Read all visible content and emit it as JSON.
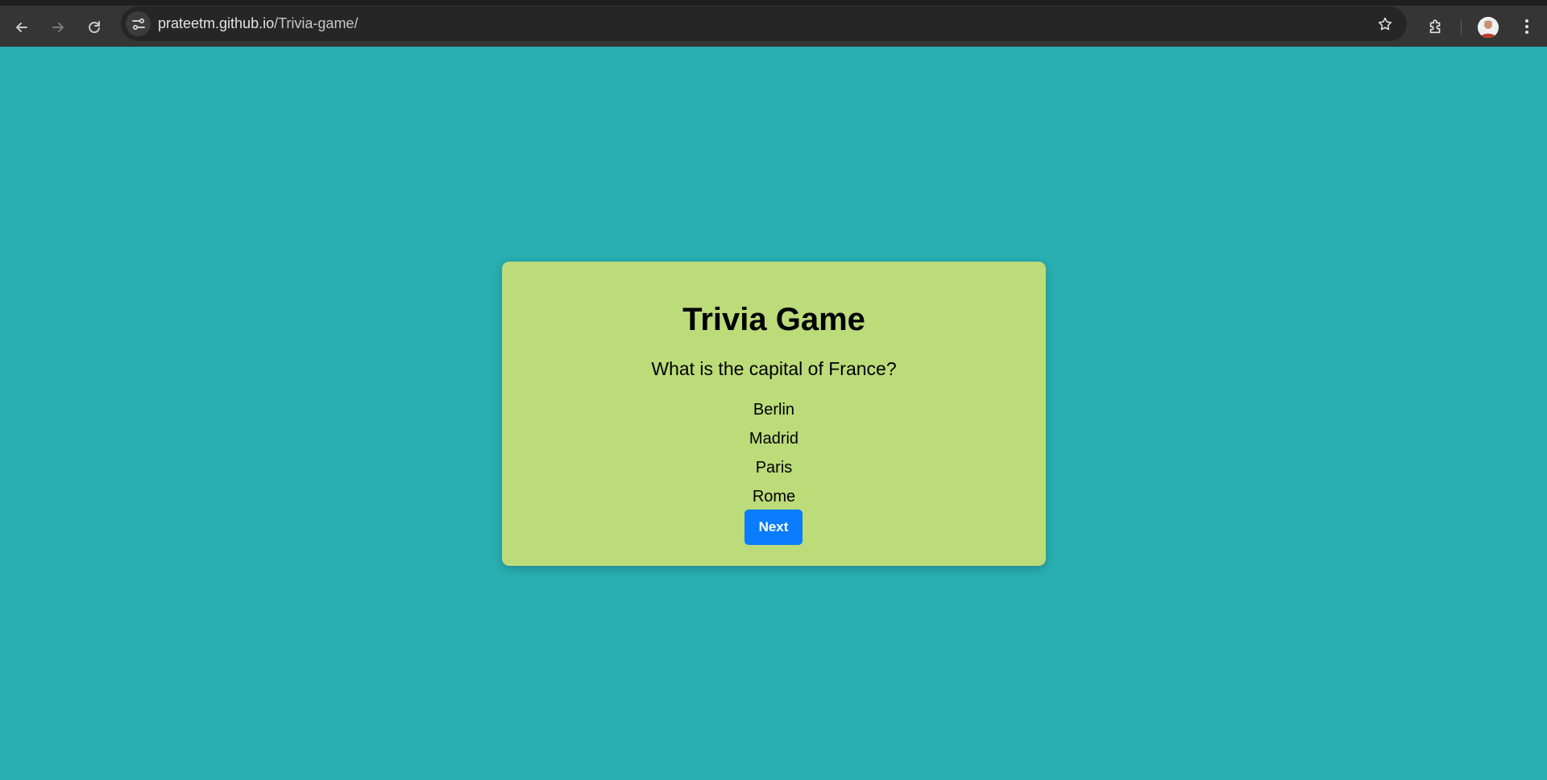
{
  "browser": {
    "url_host": "prateetm.github.io",
    "url_path": "/Trivia-game/",
    "icons": {
      "back": "arrow-left-icon",
      "forward": "arrow-right-icon",
      "reload": "reload-icon",
      "site_info": "tune-icon",
      "bookmark": "star-icon",
      "extensions": "puzzle-icon",
      "profile": "avatar",
      "menu": "kebab-menu-icon"
    }
  },
  "game": {
    "title": "Trivia Game",
    "question": "What is the capital of France?",
    "options": [
      "Berlin",
      "Madrid",
      "Paris",
      "Rome"
    ],
    "next_label": "Next"
  },
  "colors": {
    "page_background": "#29afb2",
    "card_background": "#bcdb79",
    "button_background": "#0a7cff"
  }
}
